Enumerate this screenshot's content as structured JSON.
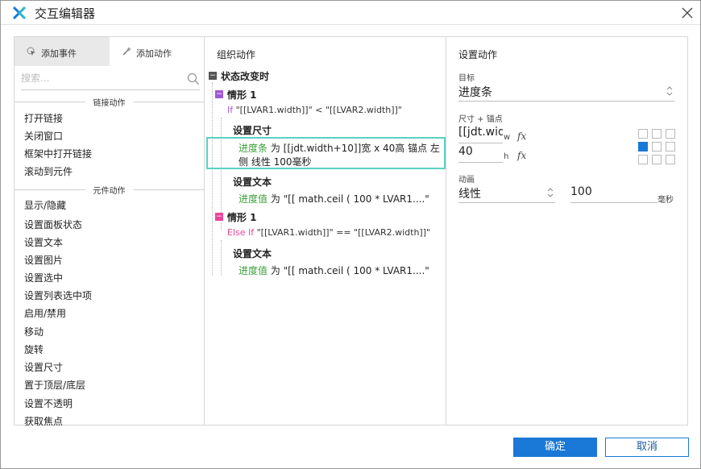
{
  "window": {
    "title": "交互编辑器"
  },
  "left_panel": {
    "tabs": [
      {
        "label": "添加事件",
        "active": true,
        "icon": "cursor-event-icon"
      },
      {
        "label": "添加动作",
        "active": false,
        "icon": "sparkle-action-icon"
      }
    ],
    "search_placeholder": "搜索...",
    "sections": [
      {
        "header": "链接动作",
        "items": [
          "打开链接",
          "关闭窗口",
          "框架中打开链接",
          "滚动到元件"
        ]
      },
      {
        "header": "元件动作",
        "items": [
          "显示/隐藏",
          "设置面板状态",
          "设置文本",
          "设置图片",
          "设置选中",
          "设置列表选中项",
          "启用/禁用",
          "移动",
          "旋转",
          "设置尺寸",
          "置于顶层/底层",
          "设置不透明",
          "获取焦点"
        ]
      }
    ]
  },
  "middle_panel": {
    "title": "组织动作",
    "event": "状态改变时",
    "cases": [
      {
        "name": "情形 1",
        "condition_keyword": "If",
        "condition": "\"[[LVAR1.width]]\" < \"[[LVAR2.width]]\"",
        "actions": [
          {
            "title": "设置尺寸",
            "target": "进度条",
            "line1": "为 [[jdt.width+10]]宽 x 40高 锚点 左",
            "line2": "侧 线性 100毫秒"
          },
          {
            "title": "设置文本",
            "target": "进度值",
            "line1": "为 \"[[ math.ceil ( 100 * LVAR1....\""
          }
        ]
      },
      {
        "name": "情形 1",
        "condition_keyword": "Else If",
        "condition": "\"[[LVAR1.width]]\" == \"[[LVAR2.width]]\"",
        "actions": [
          {
            "title": "设置文本",
            "target": "进度值",
            "line1": "为 \"[[ math.ceil ( 100 * LVAR1....\""
          }
        ]
      }
    ]
  },
  "right_panel": {
    "title": "设置动作",
    "target_label": "目标",
    "target_value": "进度条",
    "size_anchor_label": "尺寸 + 锚点",
    "width_value": "[[jdt.wid",
    "width_unit": "w",
    "height_value": "40",
    "height_unit": "h",
    "fx_symbol": "fx",
    "anchor_selected": "middle-left",
    "animation_label": "动画",
    "animation_value": "线性",
    "duration_value": "100",
    "duration_unit": "毫秒"
  },
  "footer": {
    "confirm_label": "确定",
    "cancel_label": "取消"
  },
  "colors": {
    "primary": "#1a78d6",
    "highlight": "#5bd1c4",
    "case_purple": "#a05ad6",
    "case_pink": "#e8459b",
    "target_green": "#3a9f3a"
  }
}
